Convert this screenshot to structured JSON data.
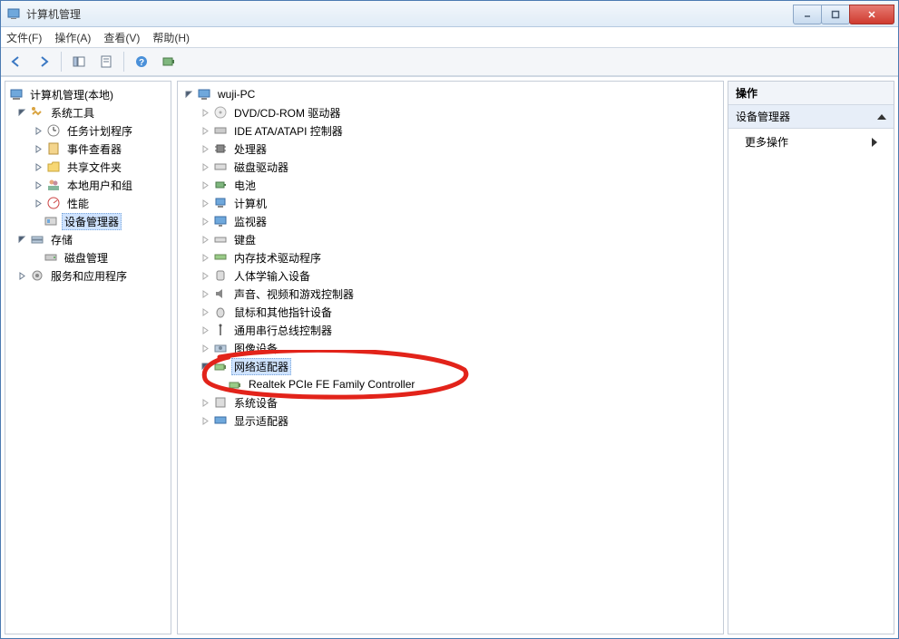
{
  "window": {
    "title": "计算机管理"
  },
  "menu": {
    "file": "文件(F)",
    "action": "操作(A)",
    "view": "查看(V)",
    "help": "帮助(H)"
  },
  "left_tree": {
    "root": "计算机管理(本地)",
    "system_tools": "系统工具",
    "task_scheduler": "任务计划程序",
    "event_viewer": "事件查看器",
    "shared_folders": "共享文件夹",
    "local_users": "本地用户和组",
    "performance": "性能",
    "device_manager": "设备管理器",
    "storage": "存储",
    "disk_mgmt": "磁盘管理",
    "services_apps": "服务和应用程序"
  },
  "center_tree": {
    "root": "wuji-PC",
    "dvd": "DVD/CD-ROM 驱动器",
    "ide": "IDE ATA/ATAPI 控制器",
    "cpu": "处理器",
    "disk_drives": "磁盘驱动器",
    "battery": "电池",
    "computer": "计算机",
    "monitor": "监视器",
    "keyboard": "键盘",
    "mem_tech": "内存技术驱动程序",
    "hid": "人体学输入设备",
    "sound": "声音、视频和游戏控制器",
    "mouse": "鼠标和其他指针设备",
    "usb": "通用串行总线控制器",
    "imaging": "图像设备",
    "network_adapters": "网络适配器",
    "network_child": "Realtek PCIe FE Family Controller",
    "system_devices": "系统设备",
    "display": "显示适配器"
  },
  "actions": {
    "header": "操作",
    "sub": "设备管理器",
    "more": "更多操作"
  }
}
